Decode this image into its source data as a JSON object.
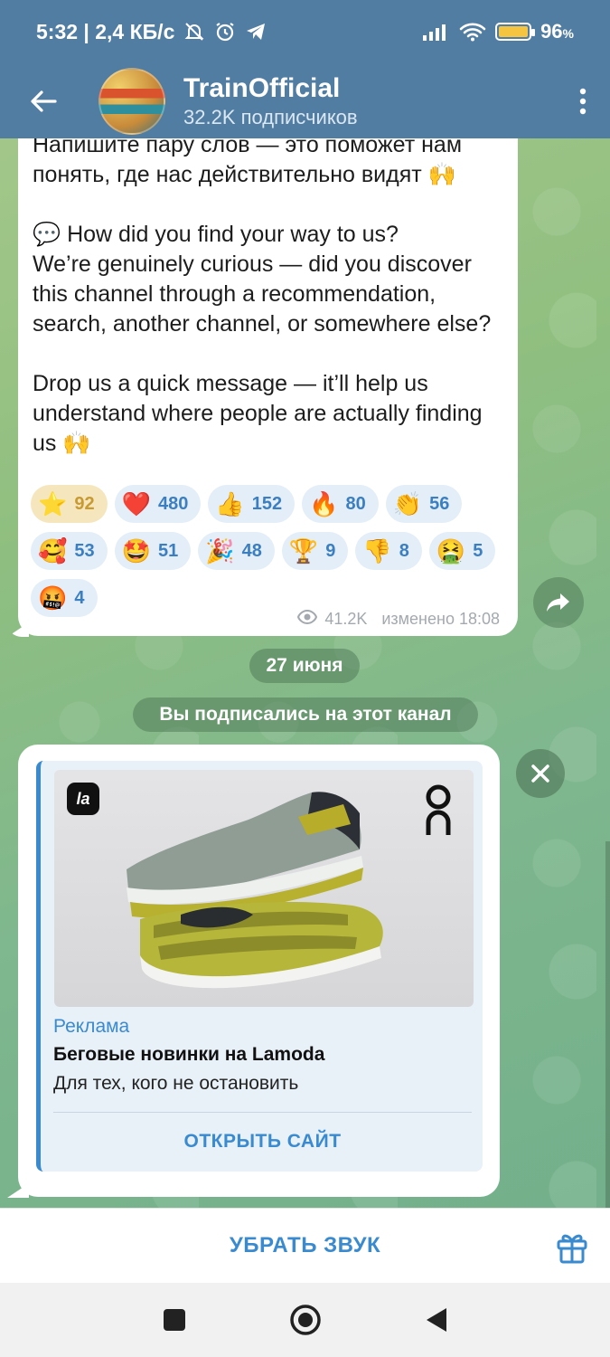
{
  "status_bar": {
    "time_info": "5:32 | 2,4 КБ/с",
    "battery_percent": "96",
    "battery_unit": "%",
    "icons": [
      "mute-bell-icon",
      "alarm-icon",
      "telegram-icon",
      "signal-icon",
      "wifi-icon",
      "battery-icon"
    ]
  },
  "header": {
    "title": "TrainOfficial",
    "subtitle": "32.2K подписчиков",
    "colors": {
      "bar": "#517da2"
    }
  },
  "message": {
    "text": "Напишите пару слов — это поможет нам\nпонять, где нас действительно видят 🙌\n\n💬 How did you find your way to us?\nWe’re genuinely curious — did you discover this channel through a recommendation, search, another channel, or somewhere else?\n\nDrop us a quick message — it’ll help us understand where people are actually finding us 🙌",
    "reactions": [
      {
        "emoji": "⭐",
        "count": "92",
        "selected": true
      },
      {
        "emoji": "❤️",
        "count": "480"
      },
      {
        "emoji": "👍",
        "count": "152"
      },
      {
        "emoji": "🔥",
        "count": "80"
      },
      {
        "emoji": "👏",
        "count": "56"
      },
      {
        "emoji": "🥰",
        "count": "53"
      },
      {
        "emoji": "🤩",
        "count": "51"
      },
      {
        "emoji": "🎉",
        "count": "48"
      },
      {
        "emoji": "🏆",
        "count": "9"
      },
      {
        "emoji": "👎",
        "count": "8"
      },
      {
        "emoji": "🤮",
        "count": "5"
      },
      {
        "emoji": "🤬",
        "count": "4"
      }
    ],
    "views": "41.2K",
    "edited": "изменено 18:08"
  },
  "service": {
    "date": "27 июня",
    "subscribed": "Вы подписались на этот канал"
  },
  "ad": {
    "label": "Реклама",
    "title": "Беговые новинки на Lamoda",
    "description": "Для тех, кого не остановить",
    "button": "ОТКРЫТЬ САЙТ",
    "logo_left": "la"
  },
  "bottom": {
    "mute_label": "УБРАТЬ ЗВУК"
  }
}
